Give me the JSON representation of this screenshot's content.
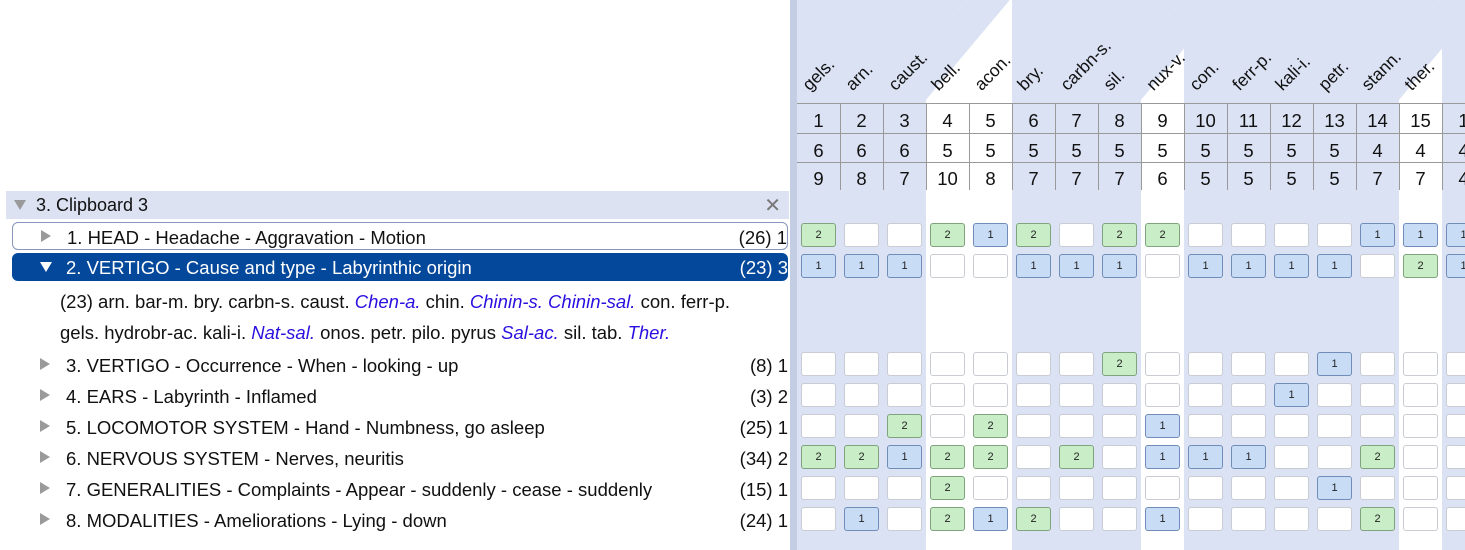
{
  "clipboard": {
    "title": "3. Clipboard 3",
    "close_icon": "close-icon"
  },
  "rubrics": [
    {
      "label": "1. HEAD - Headache - Aggravation - Motion",
      "count": "(26) 1"
    },
    {
      "label": "2. VERTIGO - Cause and type - Labyrinthic origin",
      "count": "(23) 3"
    },
    {
      "label": "3. VERTIGO - Occurrence - When - looking - up",
      "count": "(8) 1"
    },
    {
      "label": "4. EARS - Labyrinth - Inflamed",
      "count": "(3) 2"
    },
    {
      "label": "5. LOCOMOTOR SYSTEM - Hand - Numbness, go asleep",
      "count": "(25) 1"
    },
    {
      "label": "6. NERVOUS SYSTEM - Nerves, neuritis",
      "count": "(34) 2"
    },
    {
      "label": "7. GENERALITIES - Complaints - Appear - suddenly - cease - suddenly",
      "count": "(15) 1"
    },
    {
      "label": "8. MODALITIES - Ameliorations - Lying - down",
      "count": "(24) 1"
    }
  ],
  "expanded": {
    "line1": [
      {
        "t": "(23) arn. bar-m. bry. carbn-s. caust. ",
        "i": false
      },
      {
        "t": "Chen-a.",
        "i": true
      },
      {
        "t": " chin. ",
        "i": false
      },
      {
        "t": "Chinin-s.",
        "i": true
      },
      {
        "t": " ",
        "i": false
      },
      {
        "t": "Chinin-sal.",
        "i": true
      },
      {
        "t": " con. ferr-p.",
        "i": false
      }
    ],
    "line2": [
      {
        "t": "gels. hydrobr-ac. kali-i. ",
        "i": false
      },
      {
        "t": "Nat-sal.",
        "i": true
      },
      {
        "t": " onos. petr. pilo. pyrus ",
        "i": false
      },
      {
        "t": "Sal-ac.",
        "i": true
      },
      {
        "t": " sil. tab. ",
        "i": false
      },
      {
        "t": "Ther.",
        "i": true
      }
    ]
  },
  "remedies": [
    {
      "name": "gels.",
      "n": "1",
      "a": "6",
      "b": "9"
    },
    {
      "name": "arn.",
      "n": "2",
      "a": "6",
      "b": "8"
    },
    {
      "name": "caust.",
      "n": "3",
      "a": "6",
      "b": "7"
    },
    {
      "name": "bell.",
      "n": "4",
      "a": "5",
      "b": "10"
    },
    {
      "name": "acon.",
      "n": "5",
      "a": "5",
      "b": "8"
    },
    {
      "name": "bry.",
      "n": "6",
      "a": "5",
      "b": "7"
    },
    {
      "name": "carbn-s.",
      "n": "7",
      "a": "5",
      "b": "7"
    },
    {
      "name": "sil.",
      "n": "8",
      "a": "5",
      "b": "7"
    },
    {
      "name": "nux-v.",
      "n": "9",
      "a": "5",
      "b": "6"
    },
    {
      "name": "con.",
      "n": "10",
      "a": "5",
      "b": "5"
    },
    {
      "name": "ferr-p.",
      "n": "11",
      "a": "5",
      "b": "5"
    },
    {
      "name": "kali-i.",
      "n": "12",
      "a": "5",
      "b": "5"
    },
    {
      "name": "petr.",
      "n": "13",
      "a": "5",
      "b": "5"
    },
    {
      "name": "stann.",
      "n": "14",
      "a": "4",
      "b": "7"
    },
    {
      "name": "ther.",
      "n": "15",
      "a": "4",
      "b": "7"
    },
    {
      "name": "",
      "n": "1",
      "a": "4",
      "b": "4"
    }
  ],
  "grid": [
    [
      "g2",
      "",
      "",
      "g2",
      "b1",
      "g2",
      "",
      "g2",
      "g2",
      "",
      "",
      "",
      "",
      "b1",
      "b1",
      "b1"
    ],
    [
      "b1",
      "b1",
      "b1",
      "",
      "",
      "b1",
      "b1",
      "b1",
      "",
      "b1",
      "b1",
      "b1",
      "b1",
      "",
      "g2",
      "b1"
    ],
    [],
    [
      "",
      "",
      "",
      "",
      "",
      "",
      "",
      "g2",
      "",
      "",
      "",
      "",
      "b1",
      "",
      "",
      ""
    ],
    [
      "",
      "",
      "",
      "",
      "",
      "",
      "",
      "",
      "",
      "",
      "",
      "b1",
      "",
      "",
      "",
      ""
    ],
    [
      "",
      "",
      "g2",
      "",
      "g2",
      "",
      "",
      "",
      "b1",
      "",
      "",
      "",
      "",
      "",
      "",
      ""
    ],
    [
      "g2",
      "g2",
      "b1",
      "g2",
      "g2",
      "",
      "g2",
      "",
      "b1",
      "b1",
      "b1",
      "",
      "",
      "g2",
      "",
      ""
    ],
    [
      "",
      "",
      "",
      "g2",
      "",
      "",
      "",
      "",
      "",
      "",
      "",
      "",
      "b1",
      "",
      "",
      ""
    ],
    [
      "",
      "b1",
      "",
      "g2",
      "b1",
      "g2",
      "",
      "",
      "b1",
      "",
      "",
      "",
      "",
      "g2",
      "",
      ""
    ]
  ],
  "colors": {
    "selected": "#04489b",
    "strength2": "#c9edc6",
    "strength1": "#c8dcf5",
    "column_band": "#dbe2f4",
    "italic_remedy": "#2a10e0"
  }
}
